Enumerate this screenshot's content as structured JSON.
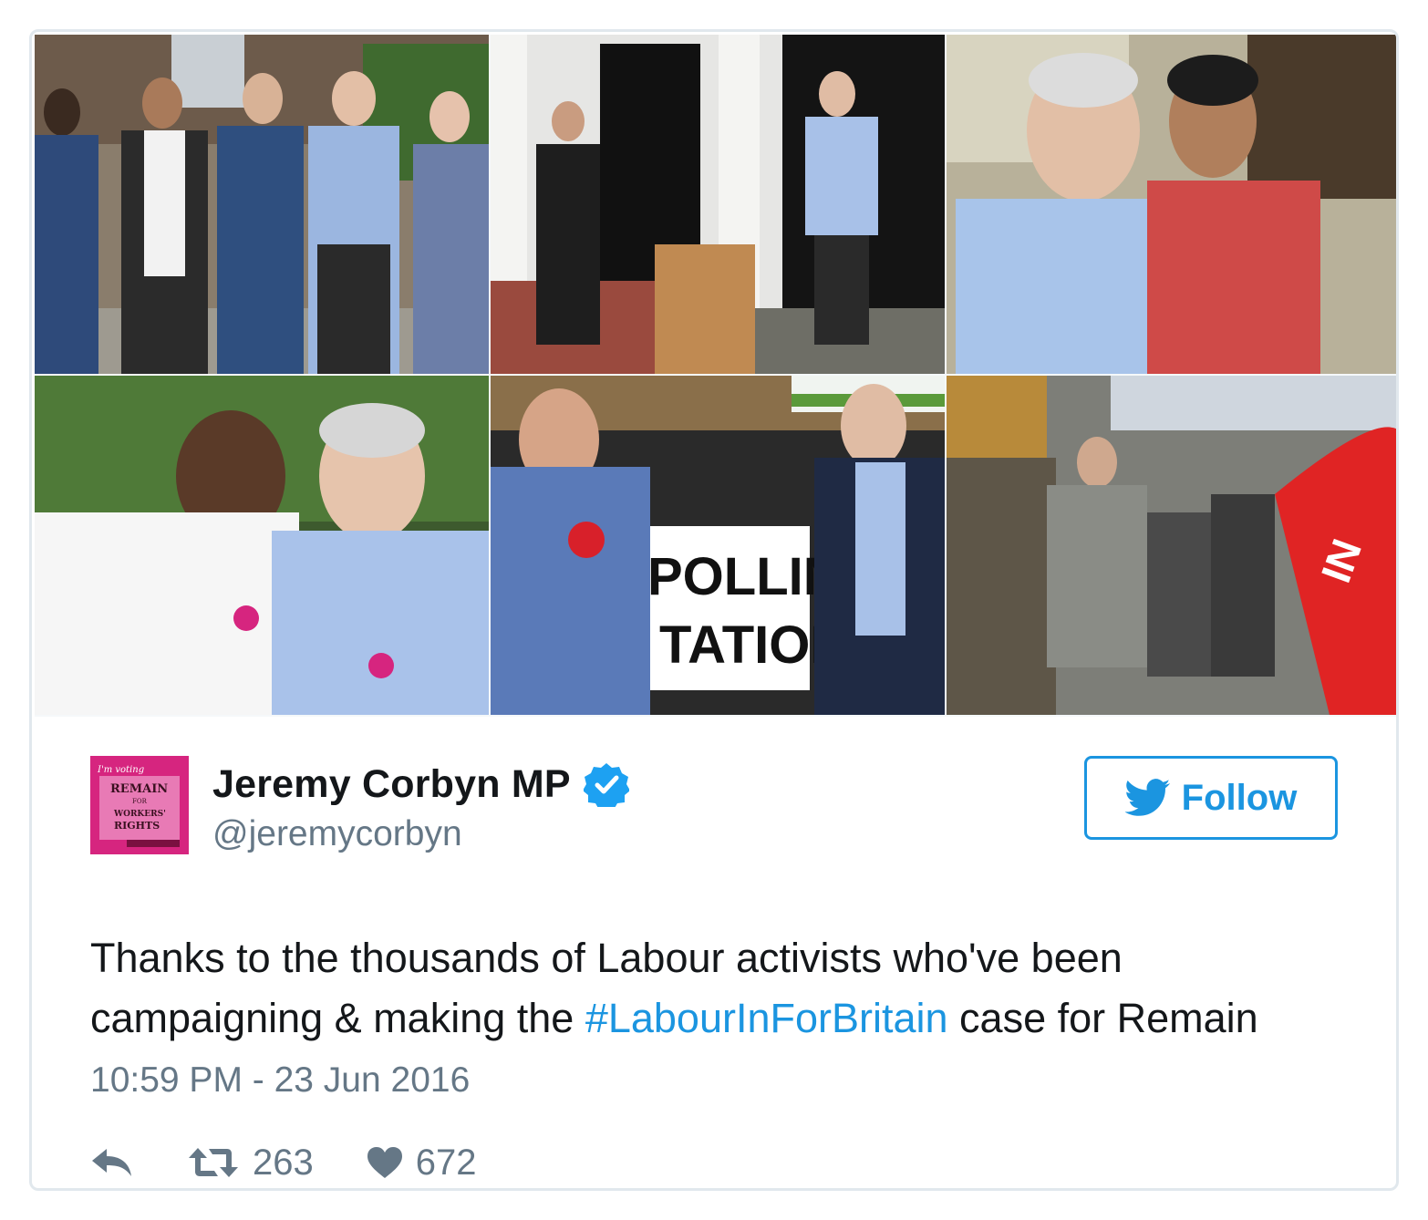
{
  "tweet": {
    "author": {
      "display_name": "Jeremy Corbyn MP",
      "handle": "@jeremycorbyn",
      "verified": true,
      "avatar_text": {
        "line1": "I'm voting",
        "line2": "REMAIN",
        "line3": "FOR",
        "line4": "WORKERS'",
        "line5": "RIGHTS"
      }
    },
    "follow_button": {
      "label": "Follow",
      "icon": "twitter-bird-icon"
    },
    "text_before": "Thanks to the thousands of Labour activists who've been campaigning & making the ",
    "hashtag": "#LabourInForBritain",
    "text_after": " case for Remain",
    "timestamp": "10:59 PM - 23 Jun 2016",
    "actions": {
      "reply_icon": "reply-icon",
      "retweet_icon": "retweet-icon",
      "retweet_count": "263",
      "like_icon": "heart-icon",
      "like_count": "672"
    },
    "photos": {
      "sign_polling": "POLLING",
      "sign_station": "TATION",
      "umbrella_text": "IN"
    }
  },
  "colors": {
    "accent": "#1b95e0",
    "text": "#14171a",
    "secondary": "#657786",
    "border": "#e1e8ed",
    "avatar_pink": "#d6257f"
  }
}
